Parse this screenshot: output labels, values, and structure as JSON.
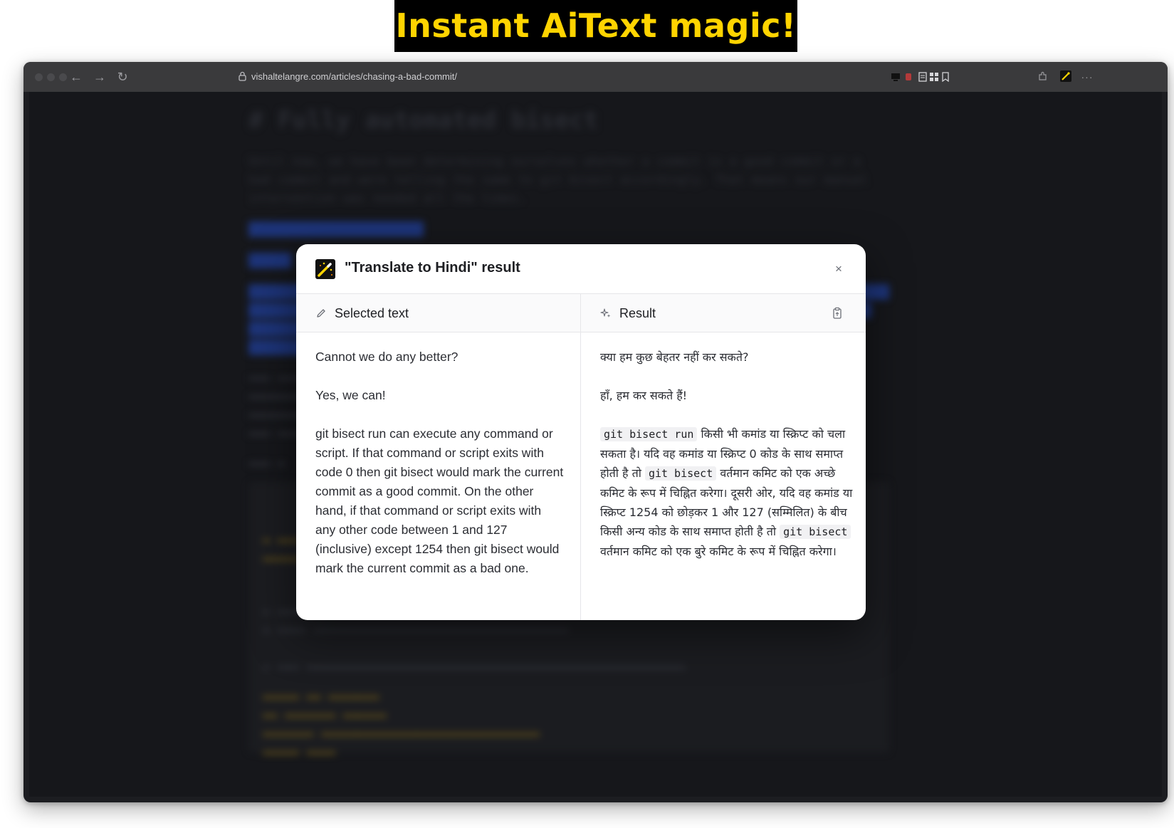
{
  "banner": {
    "text": "Instant AiText magic!"
  },
  "browser": {
    "url": "vishaltelangre.com/articles/chasing-a-bad-commit/",
    "icons": [
      "back-arrow-icon",
      "forward-arrow-icon",
      "reload-icon",
      "lock-icon",
      "extension-icon",
      "aitext-extension-icon",
      "more-icon"
    ]
  },
  "page_background": {
    "heading": "# Fully automated bisect",
    "paragraph_lines": [
      "Until now, we have been determining ourselves whether a commit is a good commit or a",
      "bad commit and were telling the same to git bisect accordingly. That means our manual",
      "intervention was needed all the times."
    ]
  },
  "modal": {
    "title": "\"Translate to Hindi\" result",
    "close_glyph": "×",
    "selected": {
      "label": "Selected text",
      "paragraphs": [
        "Cannot we do any better?",
        "Yes, we can!",
        "git bisect run can execute any command or script. If that command or script exits with code 0 then git bisect would mark the current commit as a good commit. On the other hand, if that command or script exits with any other code between 1 and 127 (inclusive) except 1254 then git bisect would mark the current commit as a bad one."
      ]
    },
    "result": {
      "label": "Result",
      "p1": "क्या हम कुछ बेहतर नहीं कर सकते?",
      "p2": "हाँ, हम कर सकते हैं!",
      "p3_code1": "git bisect run",
      "p3_text1": " किसी भी कमांड या स्क्रिप्ट को चला सकता है। यदि वह कमांड या स्क्रिप्ट 0 कोड के साथ समाप्त होती है तो ",
      "p3_code2": "git bisect",
      "p3_text2": " वर्तमान कमिट को एक अच्छे कमिट के रूप में चिह्नित करेगा। दूसरी ओर, यदि वह कमांड या स्क्रिप्ट 1254 को छोड़कर 1 और 127 (सम्मिलित) के बीच किसी अन्य कोड के साथ समाप्त होती है तो ",
      "p3_code3": "git bisect",
      "p3_text3": " वर्तमान कमिट को एक बुरे कमिट के रूप में चिह्नित करेगा।"
    }
  },
  "colors": {
    "banner_bg": "#000000",
    "banner_text": "#ffd400",
    "overlay": "#16171b",
    "modal_bg": "#ffffff"
  }
}
